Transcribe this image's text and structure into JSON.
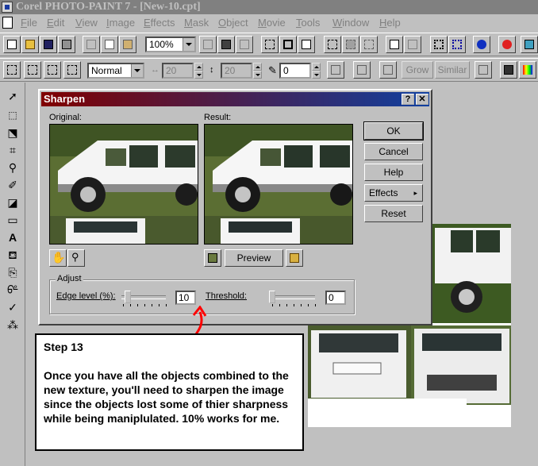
{
  "window": {
    "title": "Corel PHOTO-PAINT 7 - [New-10.cpt]"
  },
  "menu": {
    "items": [
      {
        "label": "File",
        "ul": "F",
        "rest": "ile"
      },
      {
        "label": "Edit",
        "ul": "E",
        "rest": "dit"
      },
      {
        "label": "View",
        "ul": "V",
        "rest": "iew"
      },
      {
        "label": "Image",
        "ul": "I",
        "rest": "mage"
      },
      {
        "label": "Effects",
        "ul": "E",
        "rest": "ffects"
      },
      {
        "label": "Mask",
        "ul": "M",
        "rest": "ask"
      },
      {
        "label": "Object",
        "ul": "O",
        "rest": "bject"
      },
      {
        "label": "Movie",
        "ul": "M",
        "rest": "ovie"
      },
      {
        "label": "Tools",
        "ul": "T",
        "rest": "ools"
      },
      {
        "label": "Window",
        "ul": "W",
        "rest": "indow"
      },
      {
        "label": "Help",
        "ul": "H",
        "rest": "elp"
      }
    ]
  },
  "toolbar": {
    "zoom": "100%"
  },
  "property_bar": {
    "merge_mode": "Normal",
    "width_value": "20",
    "height_value": "20",
    "tolerance_value": "0",
    "grow_label": "Grow",
    "similar_label": "Similar"
  },
  "dialog": {
    "title": "Sharpen",
    "help_glyph": "?",
    "close_glyph": "✕",
    "original_label": "Original:",
    "result_label": "Result:",
    "buttons": {
      "ok": "OK",
      "cancel": "Cancel",
      "help": "Help",
      "effects": "Effects",
      "reset": "Reset",
      "preview": "Preview"
    },
    "adjust": {
      "group_label": "Adjust",
      "edge_label": "Edge level (%):",
      "edge_value": "10",
      "edge_level_fraction": 0.1,
      "threshold_label": "Threshold:",
      "threshold_value": "0",
      "threshold_fraction": 0.0
    }
  },
  "tutorial": {
    "step_title": "Step 13",
    "body": "Once you have all the objects combined to the new texture, you'll need to sharpen the image since the objects lost some of thier sharpness while being maniplulated. 10% works for me."
  },
  "colors": {
    "arrow": "#ff0000",
    "title_gradient_start": "#800000",
    "title_gradient_end": "#1040a0"
  }
}
